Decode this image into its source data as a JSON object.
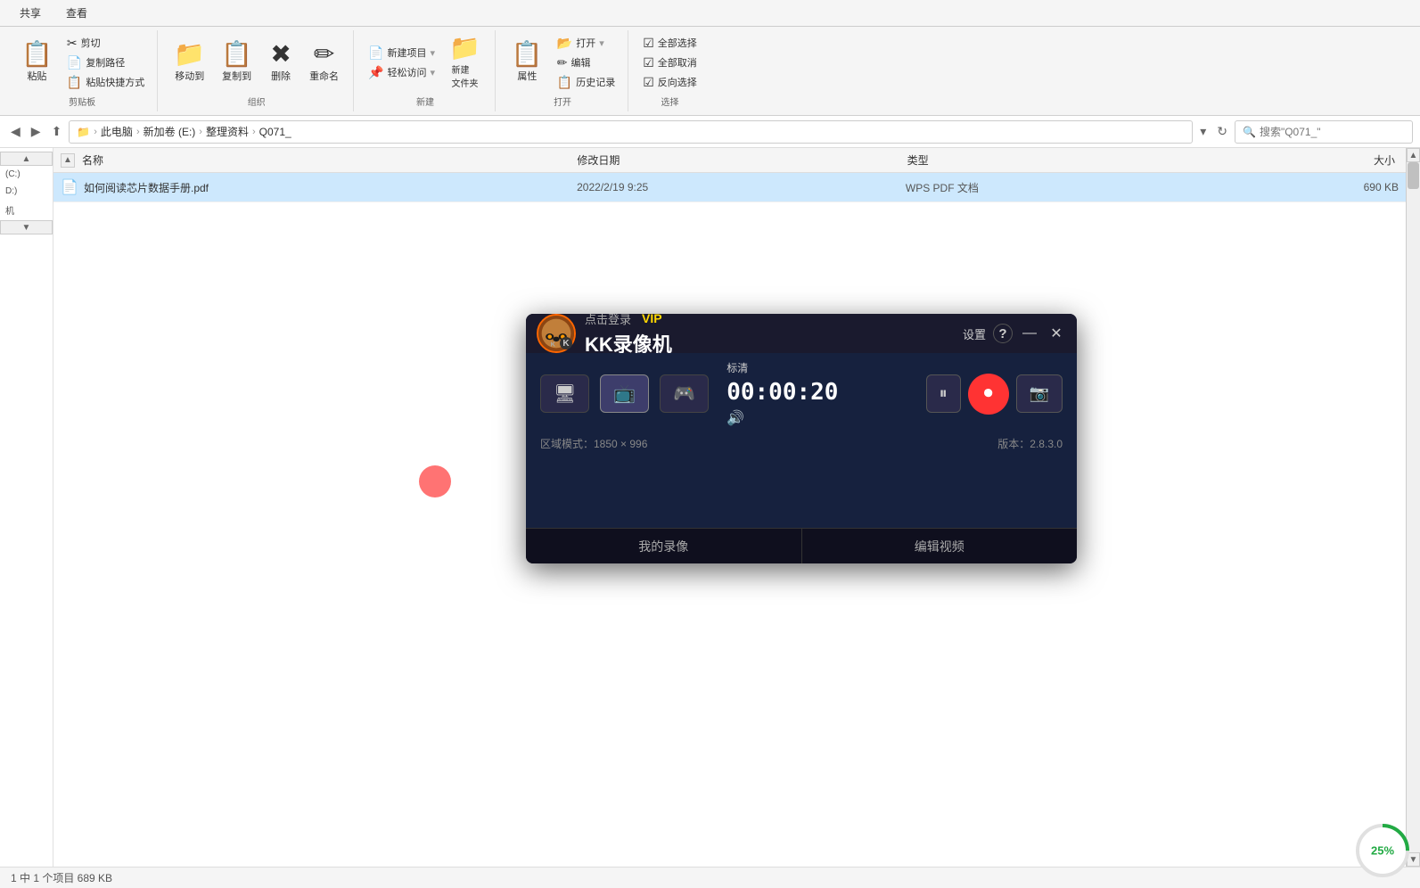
{
  "ribbon": {
    "tabs": [
      "共享",
      "查看"
    ],
    "groups": {
      "clipboard": {
        "label": "剪贴板",
        "buttons": {
          "paste": "粘贴",
          "cut": "✂ 剪切",
          "copy_path": "复制路径",
          "paste_shortcut": "粘贴快捷方式"
        }
      },
      "organize": {
        "label": "组织",
        "move_to": "移动到",
        "copy_to": "复制到",
        "delete": "删除",
        "rename": "重命名"
      },
      "new": {
        "label": "新建",
        "new_item": "新建项目",
        "easy_access": "轻松访问",
        "new_folder": "新建\n文件夹"
      },
      "open": {
        "label": "打开",
        "open_btn": "打开",
        "edit": "编辑",
        "history": "历史记录",
        "properties": "属性"
      },
      "select": {
        "label": "选择",
        "select_all": "全部选择",
        "select_none": "全部取消",
        "invert": "反向选择"
      }
    }
  },
  "addressbar": {
    "path_parts": [
      "此电脑",
      "新加卷 (E:)",
      "整理资料",
      "Q071_"
    ],
    "search_placeholder": "搜索\"Q071_\""
  },
  "columns": {
    "name": "名称",
    "date": "修改日期",
    "type": "类型",
    "size": "大小"
  },
  "files": [
    {
      "icon": "📄",
      "name": "如何阅读芯片数据手册.pdf",
      "date": "2022/2/19 9:25",
      "type": "WPS PDF 文档",
      "size": "690 KB"
    }
  ],
  "sidebar_items": [
    {
      "label": "(C:)"
    },
    {
      "label": "D:)"
    },
    {
      "label": "机"
    }
  ],
  "status_bar": {
    "text": "1 中 1 个项目  689 KB",
    "selected": ""
  },
  "kk_recorder": {
    "title": "KK录像机",
    "login": "点击登录",
    "vip": "VIP",
    "settings": "设置",
    "help": "?",
    "timer": "00:00:20",
    "quality": "标清",
    "volume_icon": "🔊",
    "region": "区域模式：1850 × 996",
    "version": "版本：2.8.3.0",
    "my_recordings": "我的录像",
    "edit_video": "编辑视频",
    "device_icons": [
      "🖥",
      "📺",
      "🎮"
    ]
  },
  "progress": {
    "percent": "25%",
    "value": 25
  }
}
